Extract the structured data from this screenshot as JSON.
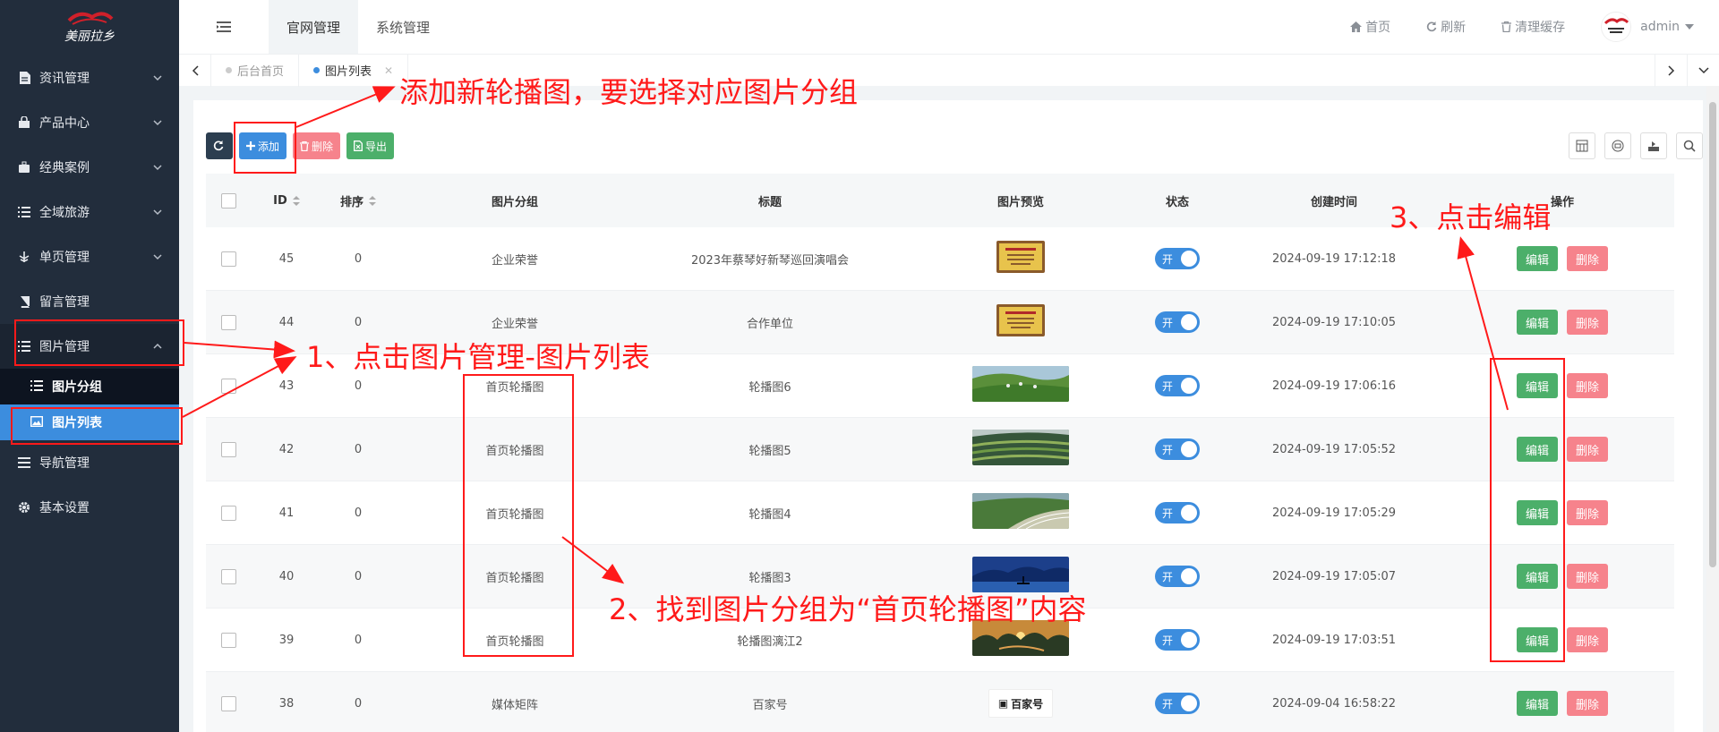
{
  "sidebar": {
    "logo_text": "美丽拉乡",
    "items": [
      {
        "label": "资讯管理",
        "icon": "document-icon"
      },
      {
        "label": "产品中心",
        "icon": "bag-icon"
      },
      {
        "label": "经典案例",
        "icon": "briefcase-icon"
      },
      {
        "label": "全域旅游",
        "icon": "list-icon"
      },
      {
        "label": "单页管理",
        "icon": "tree-icon"
      },
      {
        "label": "留言管理",
        "icon": "book-icon"
      },
      {
        "label": "图片管理",
        "icon": "list-icon"
      },
      {
        "label": "导航管理",
        "icon": "menu-icon"
      },
      {
        "label": "基本设置",
        "icon": "gear-icon"
      }
    ],
    "sub_items": [
      {
        "label": "图片分组",
        "icon": "list-icon"
      },
      {
        "label": "图片列表",
        "icon": "image-icon"
      }
    ]
  },
  "header": {
    "tabs": [
      "官网管理",
      "系统管理"
    ],
    "links": [
      "首页",
      "刷新",
      "清理缓存"
    ],
    "user": "admin"
  },
  "page_tabs": [
    {
      "label": "后台首页"
    },
    {
      "label": "图片列表"
    }
  ],
  "toolbar": {
    "add": "添加",
    "delete": "删除",
    "export": "导出"
  },
  "table": {
    "columns": [
      "ID",
      "排序",
      "图片分组",
      "标题",
      "图片预览",
      "状态",
      "创建时间",
      "操作"
    ],
    "rows": [
      {
        "id": "45",
        "sort": "0",
        "group": "企业荣誉",
        "title": "2023年蔡琴好新琴巡回演唱会",
        "preview": "cert",
        "status": "开",
        "time": "2024-09-19 17:12:18"
      },
      {
        "id": "44",
        "sort": "0",
        "group": "企业荣誉",
        "title": "合作单位",
        "preview": "cert",
        "status": "开",
        "time": "2024-09-19 17:10:05"
      },
      {
        "id": "43",
        "sort": "0",
        "group": "首页轮播图",
        "title": "轮播图6",
        "preview": "landscape-green",
        "status": "开",
        "time": "2024-09-19 17:06:16"
      },
      {
        "id": "42",
        "sort": "0",
        "group": "首页轮播图",
        "title": "轮播图5",
        "preview": "landscape-terrace",
        "status": "开",
        "time": "2024-09-19 17:05:52"
      },
      {
        "id": "41",
        "sort": "0",
        "group": "首页轮播图",
        "title": "轮播图4",
        "preview": "landscape-field",
        "status": "开",
        "time": "2024-09-19 17:05:29"
      },
      {
        "id": "40",
        "sort": "0",
        "group": "首页轮播图",
        "title": "轮播图3",
        "preview": "landscape-blue",
        "status": "开",
        "time": "2024-09-19 17:05:07"
      },
      {
        "id": "39",
        "sort": "0",
        "group": "首页轮播图",
        "title": "轮播图漓江2",
        "preview": "landscape-sunset",
        "status": "开",
        "time": "2024-09-19 17:03:51"
      },
      {
        "id": "38",
        "sort": "0",
        "group": "媒体矩阵",
        "title": "百家号",
        "preview": "logo",
        "preview_text": "百家号",
        "status": "开",
        "time": "2024-09-04 16:58:22"
      }
    ],
    "edit_label": "编辑",
    "delete_label": "删除"
  },
  "annotations": {
    "a1": "添加新轮播图，要选择对应图片分组",
    "a2": "1、点击图片管理-图片列表",
    "a3": "2、找到图片分组为“首页轮播图”内容",
    "a4": "3、点击编辑"
  },
  "colors": {
    "sidebar_bg": "#222d3c",
    "accent": "#3c8dde",
    "success": "#4caf6a",
    "danger": "#f6838c",
    "annotation": "#ff1a1a"
  }
}
